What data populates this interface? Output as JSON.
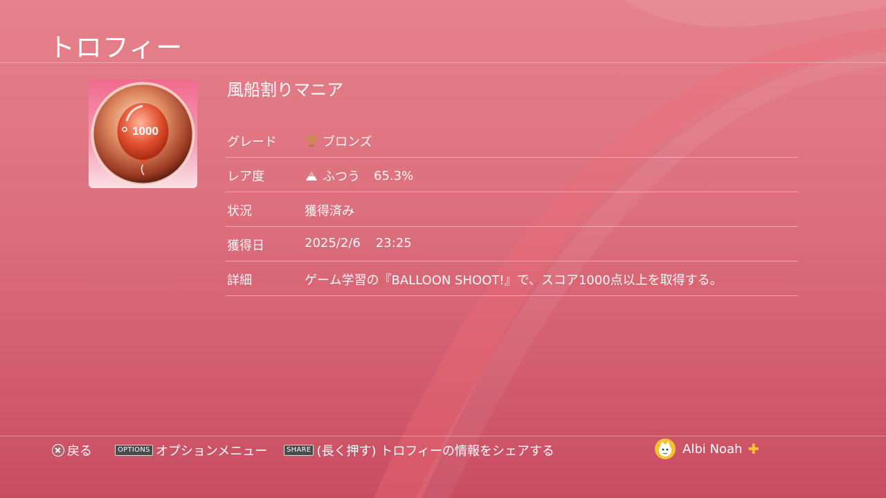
{
  "header": {
    "title": "トロフィー"
  },
  "trophy": {
    "name": "風船割りマニア",
    "icon_text": "1000",
    "icon": "balloon-trophy-icon"
  },
  "details": {
    "grade": {
      "label": "グレード",
      "value": "ブロンズ",
      "icon": "bronze-trophy-icon"
    },
    "rarity": {
      "label": "レア度",
      "value": "ふつう",
      "percent": "65.3%",
      "icon": "rarity-pyramid-icon"
    },
    "status": {
      "label": "状況",
      "value": "獲得済み"
    },
    "earned": {
      "label": "獲得日",
      "date": "2025/2/6",
      "time": "23:25"
    },
    "description": {
      "label": "詳細",
      "value": "ゲーム学習の『BALLOON SHOOT!』で、スコア1000点以上を取得する。"
    }
  },
  "footer": {
    "back": {
      "icon": "cross-button-icon",
      "label": "戻る"
    },
    "options": {
      "key": "OPTIONS",
      "label": "オプションメニュー"
    },
    "share": {
      "key": "SHARE",
      "label": "(長く押す) トロフィーの情報をシェアする"
    },
    "user": {
      "name": "Albi Noah",
      "icon": "ps-plus-icon",
      "avatar": "avatar"
    }
  },
  "colors": {
    "background_top": "#e5828c",
    "background_bottom": "#c94d61",
    "plus": "#f7c234"
  }
}
